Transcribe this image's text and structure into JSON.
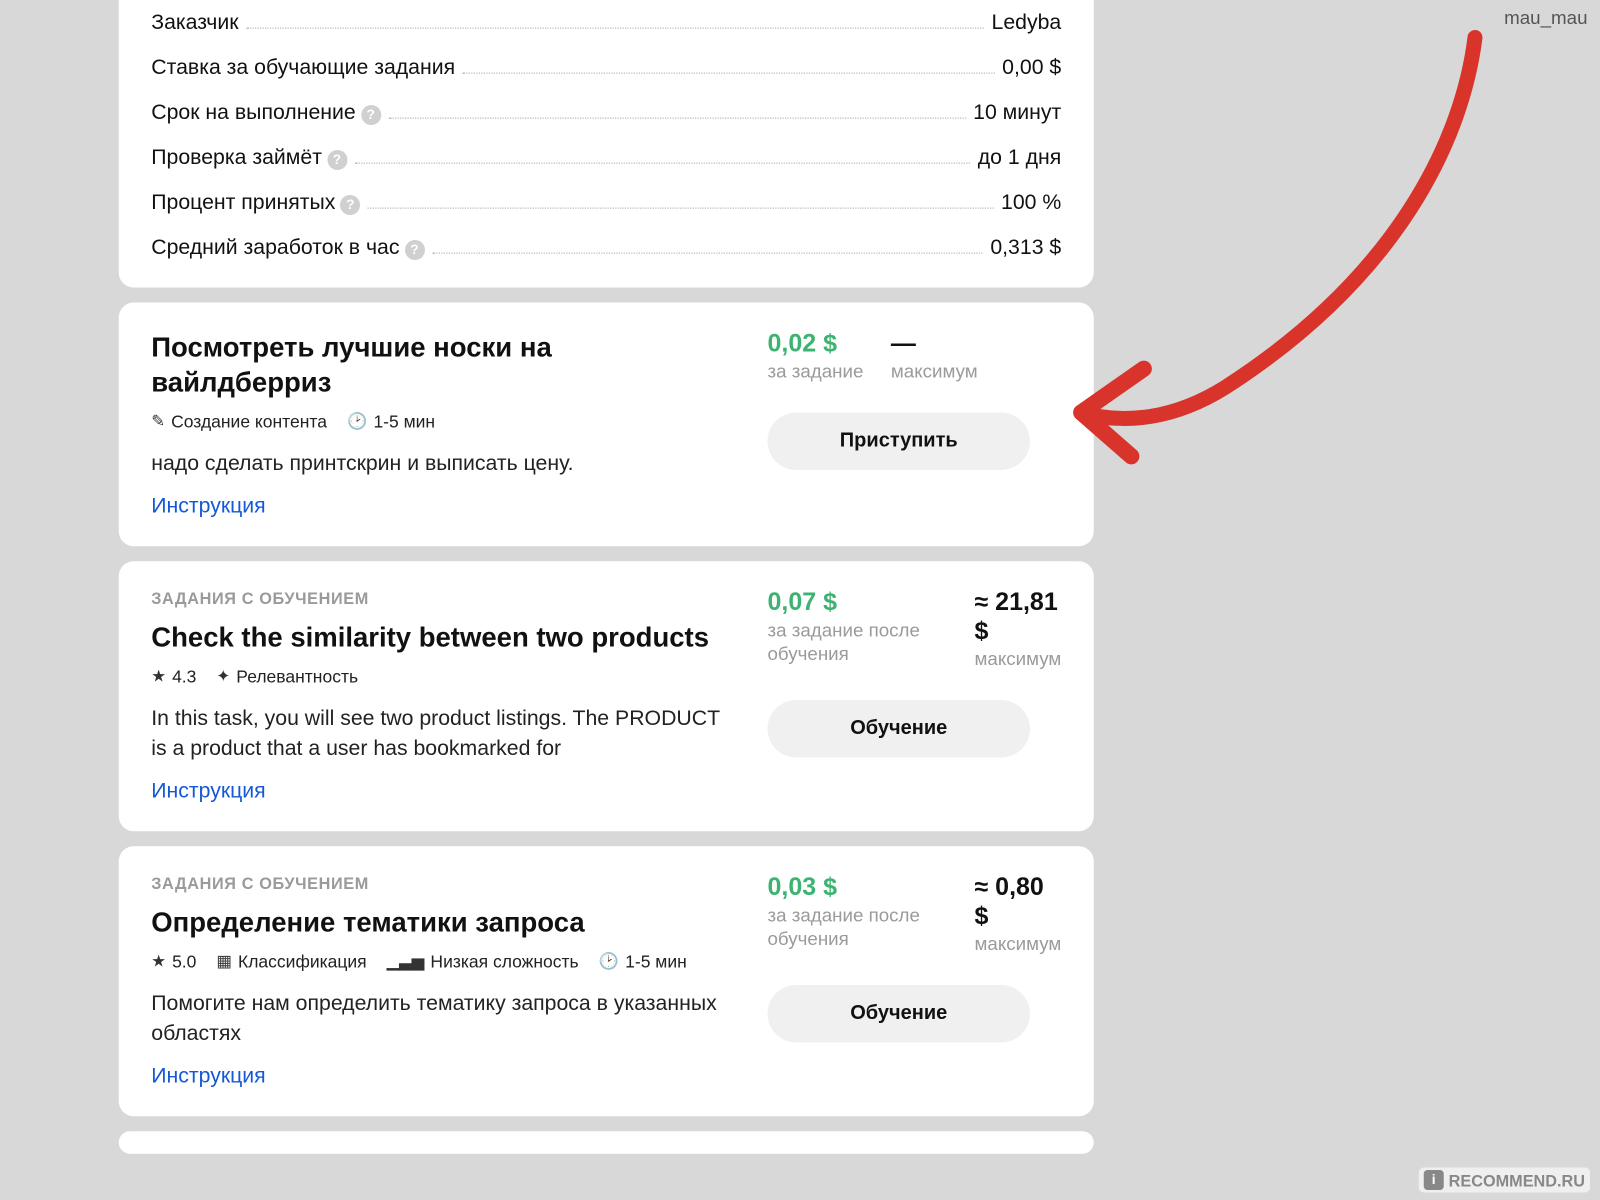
{
  "watermarks": {
    "top": "mau_mau",
    "bottom": "RECOMMEND.RU"
  },
  "details": {
    "rows": [
      {
        "label": "Заказчик",
        "value": "Ledyba",
        "help": false
      },
      {
        "label": "Ставка за обучающие задания",
        "value": "0,00 $",
        "help": false
      },
      {
        "label": "Срок на выполнение",
        "value": "10 минут",
        "help": true
      },
      {
        "label": "Проверка займёт",
        "value": "до 1 дня",
        "help": true
      },
      {
        "label": "Процент принятых",
        "value": "100 %",
        "help": true
      },
      {
        "label": "Средний заработок в час",
        "value": "0,313 $",
        "help": true
      }
    ]
  },
  "labels": {
    "per_task": "за задание",
    "per_task_after": "за задание после обучения",
    "maximum": "максимум",
    "instruction": "Инструкция",
    "training_badge": "ЗАДАНИЯ С ОБУЧЕНИЕМ",
    "start_btn": "Приступить",
    "train_btn": "Обучение",
    "dash": "—"
  },
  "tasks": [
    {
      "title": "Посмотреть лучшие носки на вайлдберриз",
      "meta": [
        {
          "icon": "pencil",
          "text": "Создание контента"
        },
        {
          "icon": "clock",
          "text": "1-5 мин"
        }
      ],
      "desc": "надо сделать принтскрин и выписать цену.",
      "price": "0,02 $",
      "max": "—",
      "has_training": false,
      "button": "start"
    },
    {
      "title": "Check the similarity between two products",
      "meta": [
        {
          "icon": "star",
          "text": "4.3"
        },
        {
          "icon": "puzzle",
          "text": "Релевантность"
        }
      ],
      "desc": "In this task, you will see two product listings. The PRODUCT is a product that a user has bookmarked for",
      "price": "0,07 $",
      "max": "≈ 21,81 $",
      "has_training": true,
      "button": "train"
    },
    {
      "title": "Определение тематики запроса",
      "meta": [
        {
          "icon": "star",
          "text": "5.0"
        },
        {
          "icon": "grid",
          "text": "Классификация"
        },
        {
          "icon": "bars",
          "text": "Низкая сложность"
        },
        {
          "icon": "clock",
          "text": "1-5 мин"
        }
      ],
      "desc": "Помогите нам определить тематику запроса в указанных областях",
      "price": "0,03 $",
      "max": "≈ 0,80 $",
      "has_training": true,
      "button": "train"
    }
  ]
}
